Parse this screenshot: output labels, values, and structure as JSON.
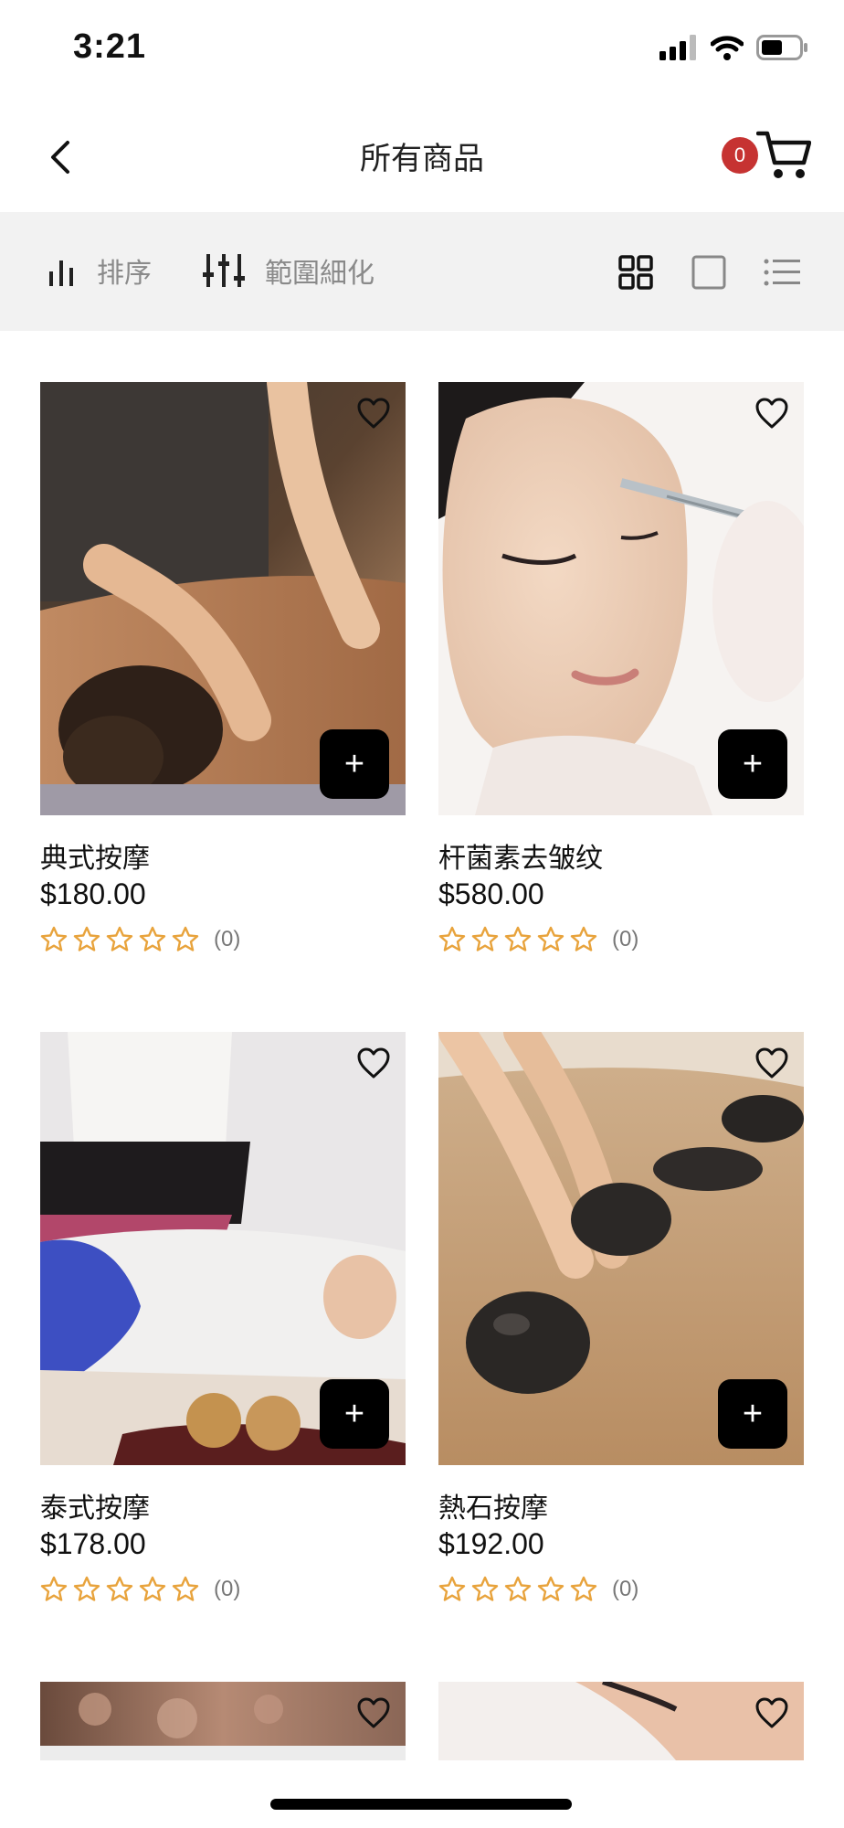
{
  "status_bar": {
    "time": "3:21"
  },
  "header": {
    "title": "所有商品",
    "cart_count": "0"
  },
  "toolbar": {
    "sort_label": "排序",
    "filter_label": "範圍細化"
  },
  "products": [
    {
      "name": "典式按摩",
      "price": "$180.00",
      "rating_count": "(0)"
    },
    {
      "name": "杆菌素去皱纹",
      "price": "$580.00",
      "rating_count": "(0)"
    },
    {
      "name": "泰式按摩",
      "price": "$178.00",
      "rating_count": "(0)"
    },
    {
      "name": "熱石按摩",
      "price": "$192.00",
      "rating_count": "(0)"
    }
  ],
  "colors": {
    "star": "#e8a33c",
    "badge": "#c63332",
    "toolbar_bg": "#f2f2f2"
  },
  "icons": [
    "back-arrow-icon",
    "cart-icon",
    "sort-bars-icon",
    "filter-sliders-icon",
    "grid-view-icon",
    "single-view-icon",
    "list-view-icon",
    "heart-icon",
    "plus-icon",
    "star-outline-icon"
  ]
}
